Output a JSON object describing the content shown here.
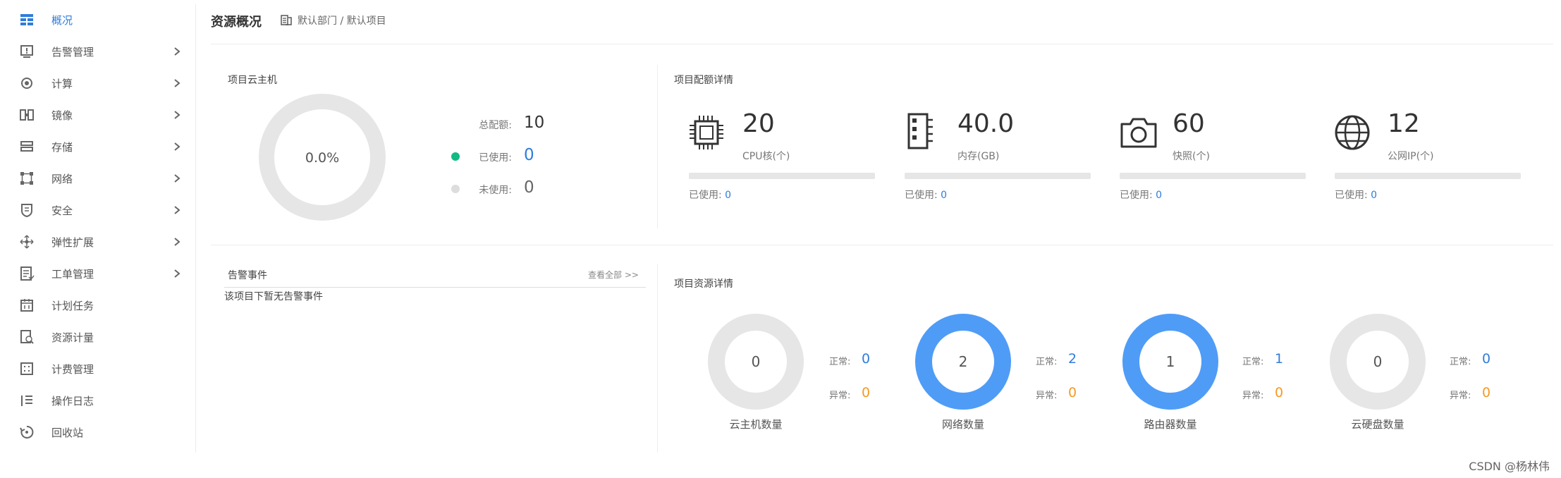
{
  "sidebar": {
    "items": [
      {
        "label": "概况",
        "icon": "dashboard-grid-icon",
        "has_children": false,
        "active": true
      },
      {
        "label": "告警管理",
        "icon": "alarm-icon",
        "has_children": true,
        "active": false
      },
      {
        "label": "计算",
        "icon": "compute-icon",
        "has_children": true,
        "active": false
      },
      {
        "label": "镜像",
        "icon": "image-icon",
        "has_children": true,
        "active": false
      },
      {
        "label": "存储",
        "icon": "storage-icon",
        "has_children": true,
        "active": false
      },
      {
        "label": "网络",
        "icon": "network-icon",
        "has_children": true,
        "active": false
      },
      {
        "label": "安全",
        "icon": "shield-icon",
        "has_children": true,
        "active": false
      },
      {
        "label": "弹性扩展",
        "icon": "scaling-icon",
        "has_children": true,
        "active": false
      },
      {
        "label": "工单管理",
        "icon": "ticket-icon",
        "has_children": true,
        "active": false
      },
      {
        "label": "计划任务",
        "icon": "schedule-icon",
        "has_children": false,
        "active": false
      },
      {
        "label": "资源计量",
        "icon": "metering-icon",
        "has_children": false,
        "active": false
      },
      {
        "label": "计费管理",
        "icon": "billing-icon",
        "has_children": false,
        "active": false
      },
      {
        "label": "操作日志",
        "icon": "log-icon",
        "has_children": false,
        "active": false
      },
      {
        "label": "回收站",
        "icon": "recycle-icon",
        "has_children": false,
        "active": false
      }
    ]
  },
  "header": {
    "title": "资源概况",
    "breadcrumb": "默认部门 / 默认项目"
  },
  "vm": {
    "title": "项目云主机",
    "percent": "0.0%",
    "used_fraction": 0,
    "total_label": "总配额:",
    "total_value": "10",
    "used_label": "已使用:",
    "used_value": "0",
    "unused_label": "未使用:",
    "unused_value": "0"
  },
  "quota": {
    "title": "项目配额详情",
    "used_label": "已使用:",
    "items": [
      {
        "value": "20",
        "label": "CPU核(个)",
        "used": "0",
        "used_fraction": 0,
        "icon": "cpu-icon"
      },
      {
        "value": "40.0",
        "label": "内存(GB)",
        "used": "0",
        "used_fraction": 0,
        "icon": "memory-icon"
      },
      {
        "value": "60",
        "label": "快照(个)",
        "used": "0",
        "used_fraction": 0,
        "icon": "camera-icon"
      },
      {
        "value": "12",
        "label": "公网IP(个)",
        "used": "0",
        "used_fraction": 0,
        "icon": "globe-icon"
      }
    ]
  },
  "alarms": {
    "title": "告警事件",
    "view_all": "查看全部 >>",
    "empty_text": "该项目下暂无告警事件"
  },
  "resources": {
    "title": "项目资源详情",
    "normal_label": "正常:",
    "abnormal_label": "异常:",
    "items": [
      {
        "count": "0",
        "label": "云主机数量",
        "normal": "0",
        "abnormal": "0",
        "active": false
      },
      {
        "count": "2",
        "label": "网络数量",
        "normal": "2",
        "abnormal": "0",
        "active": true
      },
      {
        "count": "1",
        "label": "路由器数量",
        "normal": "1",
        "abnormal": "0",
        "active": true
      },
      {
        "count": "0",
        "label": "云硬盘数量",
        "normal": "0",
        "abnormal": "0",
        "active": false
      }
    ]
  },
  "colors": {
    "accent": "#2f7ddb",
    "donut_active": "#4f9cf7",
    "donut_idle": "#e6e6e6",
    "used_dot": "#13ba84",
    "unused_dot": "#dddddd",
    "warning": "#f59a23"
  },
  "watermark": "CSDN @杨林伟"
}
